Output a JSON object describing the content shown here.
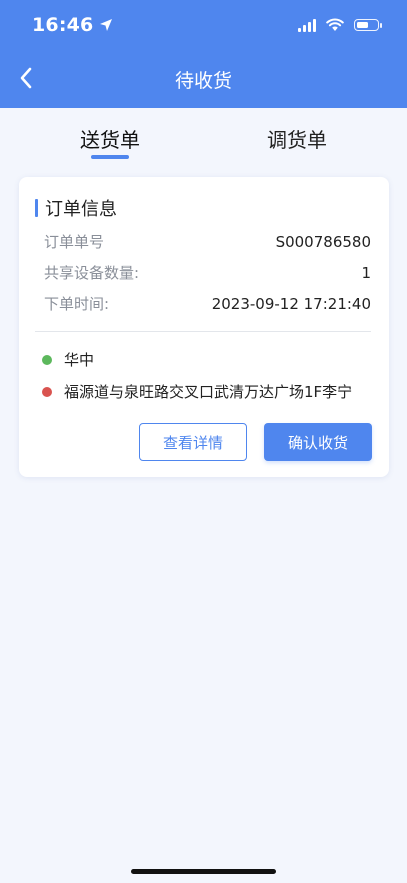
{
  "status_bar": {
    "time": "16:46",
    "battery_level": 0.62
  },
  "nav": {
    "title": "待收货",
    "back_icon": "chevron-left-icon"
  },
  "tabs": [
    {
      "label": "送货单",
      "active": true
    },
    {
      "label": "调货单",
      "active": false
    }
  ],
  "card": {
    "section_title": "订单信息",
    "fields": [
      {
        "label": "订单单号",
        "value": "S000786580"
      },
      {
        "label": "共享设备数量:",
        "value": "1"
      },
      {
        "label": "下单时间:",
        "value": "2023-09-12 17:21:40"
      }
    ],
    "locations": [
      {
        "text": "华中",
        "color": "#5CB85C"
      },
      {
        "text": "福源道与泉旺路交叉口武清万达广场1F李宁",
        "color": "#D9534F"
      }
    ],
    "buttons": {
      "detail": "查看详情",
      "confirm": "确认收货"
    }
  },
  "colors": {
    "primary": "#4F86EE",
    "background": "#F3F6FD"
  }
}
